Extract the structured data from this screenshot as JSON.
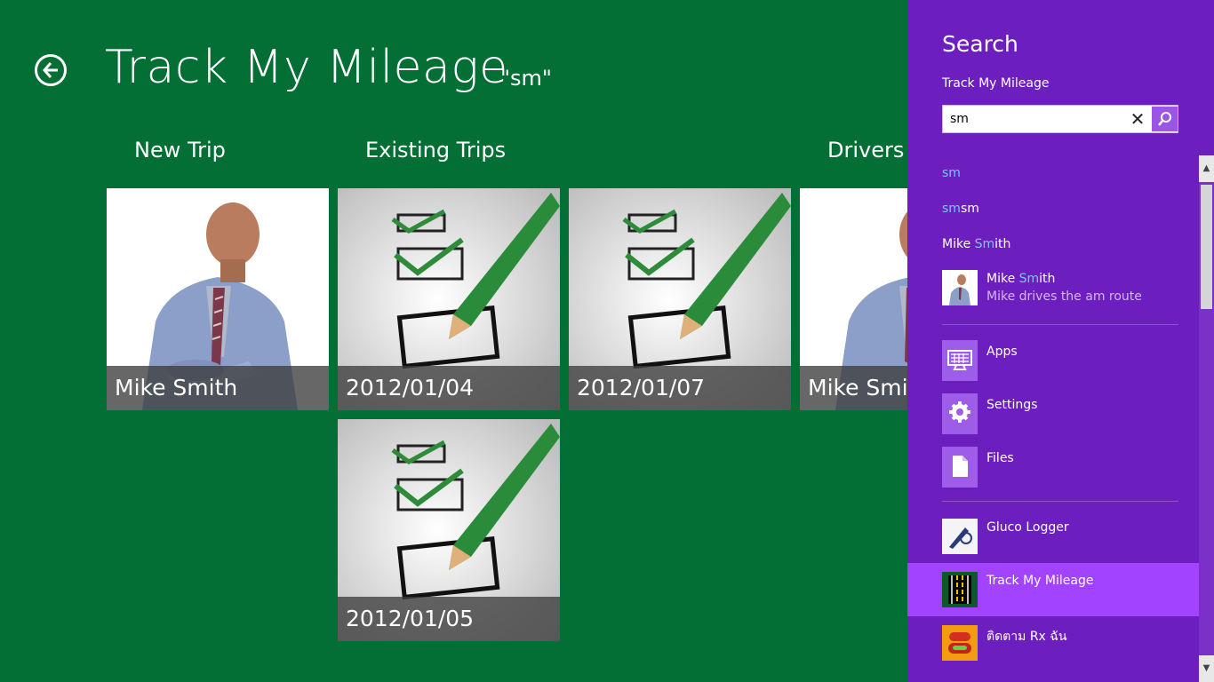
{
  "app": {
    "title": "Track My Mileage",
    "query_display": "\"sm\"",
    "groups": [
      {
        "label": "New Trip"
      },
      {
        "label": "Existing Trips"
      },
      {
        "label": "Drivers"
      }
    ],
    "tiles": [
      {
        "caption": "Mike Smith",
        "kind": "person"
      },
      {
        "caption": "2012/01/04",
        "kind": "checklist"
      },
      {
        "caption": "2012/01/07",
        "kind": "checklist"
      },
      {
        "caption": "Mike Smith",
        "kind": "person"
      },
      {
        "caption": "2012/01/05",
        "kind": "checklist"
      }
    ]
  },
  "search_pane": {
    "title": "Search",
    "app_name": "Track My Mileage",
    "query": "sm",
    "suggestions": [
      {
        "match": "sm",
        "rest": ""
      },
      {
        "match": "sm",
        "rest": "sm"
      },
      {
        "prefix": "Mike ",
        "match": "Sm",
        "rest": "ith"
      }
    ],
    "result": {
      "prefix": "Mike ",
      "match": "Sm",
      "rest": "ith",
      "subtitle": "Mike drives the am route"
    },
    "categories": [
      {
        "label": "Apps",
        "icon": "apps-icon"
      },
      {
        "label": "Settings",
        "icon": "gear-icon"
      },
      {
        "label": "Files",
        "icon": "file-icon"
      }
    ],
    "apps": [
      {
        "label": "Gluco Logger",
        "icon": "gluco-logger-icon"
      },
      {
        "label": "Track My Mileage",
        "icon": "road-icon",
        "selected": true
      },
      {
        "label": "ติดตาม Rx ฉัน",
        "icon": "pills-icon"
      }
    ]
  },
  "colors": {
    "app_bg": "#036f34",
    "pane_bg": "#6d1ebe",
    "selected_bg": "#a143ff",
    "highlight": "#7fc3ff"
  }
}
